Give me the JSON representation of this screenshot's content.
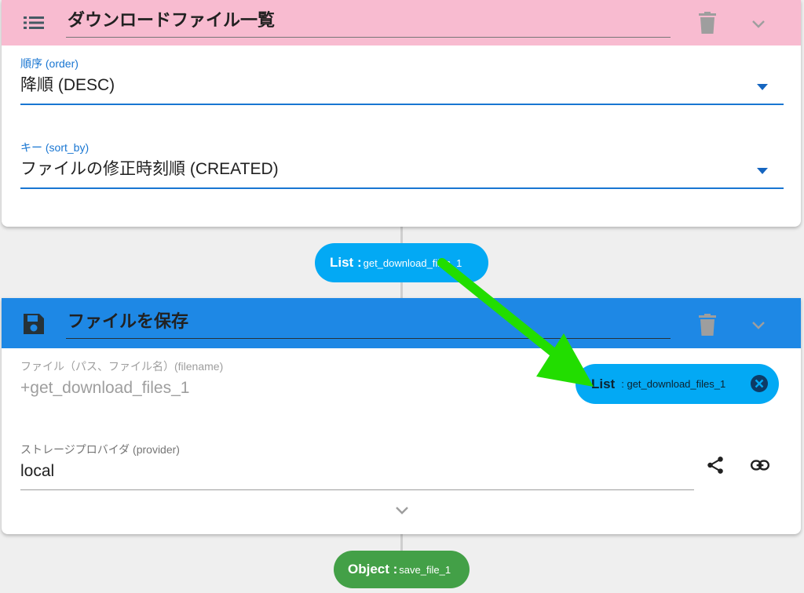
{
  "colors": {
    "card1_header": "#f8bbd0",
    "card2_header": "#1e88e5",
    "accent_blue": "#1976d2",
    "pill_blue": "#03a9f4",
    "pill_green": "#43a047",
    "arrow_green": "#22dd00"
  },
  "card1": {
    "header_icon": "list-icon",
    "title": "ダウンロードファイル一覧",
    "order": {
      "label": "順序 (order)",
      "value": "降順 (DESC)"
    },
    "sort_by": {
      "label": "キー (sort_by)",
      "value": "ファイルの修正時刻順 (CREATED)"
    }
  },
  "output1": {
    "type": "List :",
    "name": "get_download_files_1"
  },
  "card2": {
    "header_icon": "save-icon",
    "title": "ファイルを保存",
    "filename": {
      "label": "ファイル（パス、ファイル名）(filename)",
      "value": "+get_download_files_1",
      "chip_type": "List",
      "chip_name": ": get_download_files_1"
    },
    "provider": {
      "label": "ストレージプロバイダ (provider)",
      "value": "local"
    }
  },
  "output2": {
    "type": "Object :",
    "name": "save_file_1"
  }
}
